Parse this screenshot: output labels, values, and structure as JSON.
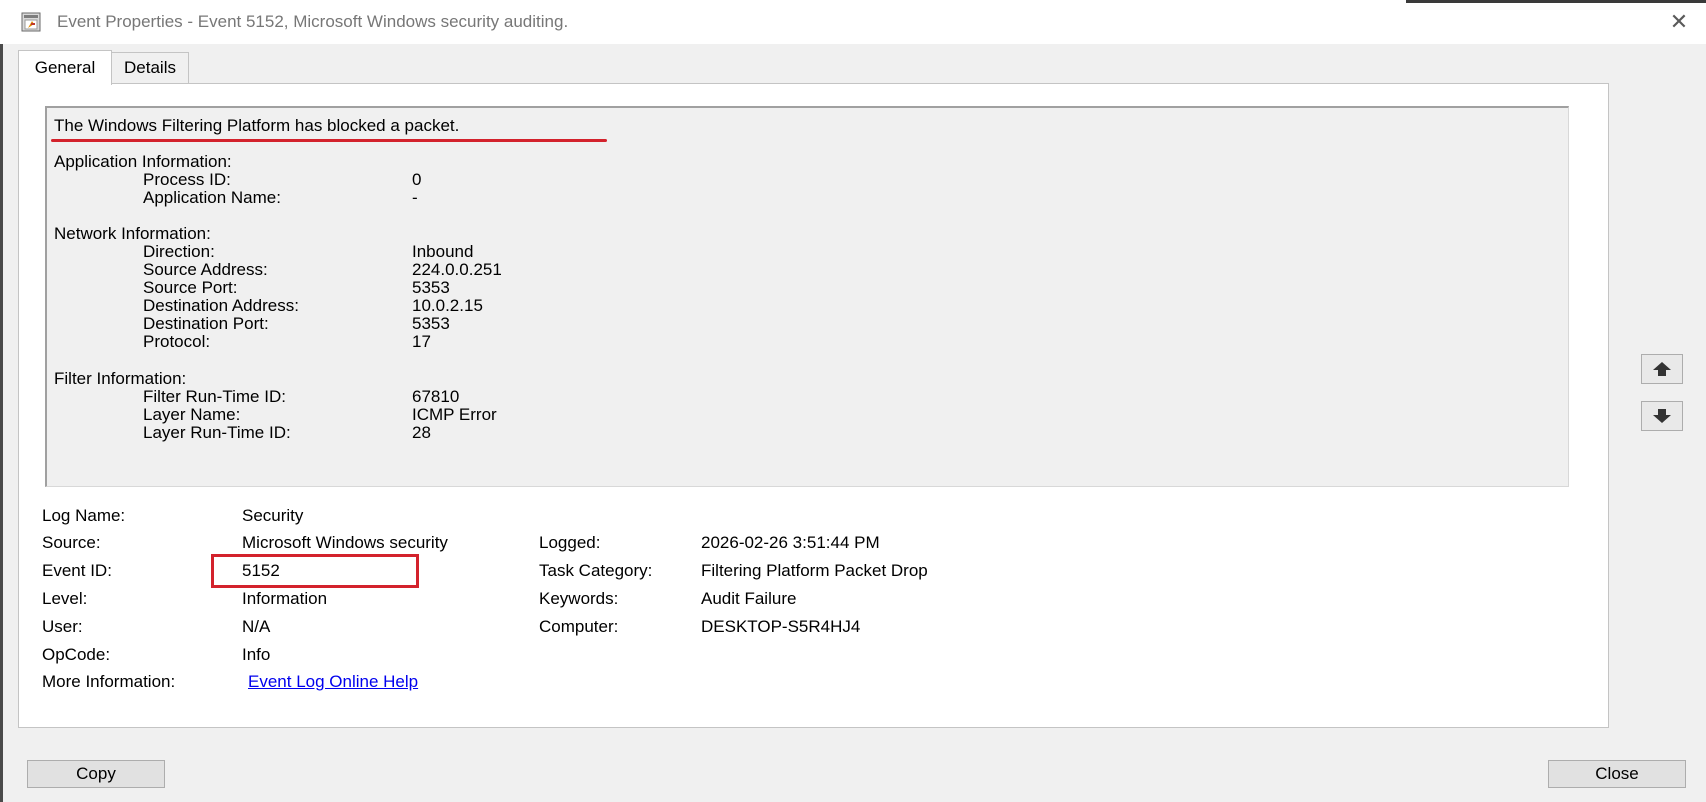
{
  "window": {
    "title": "Event Properties - Event 5152, Microsoft Windows security auditing.",
    "close_glyph": "✕"
  },
  "tabs": [
    {
      "label": "General",
      "active": true
    },
    {
      "label": "Details",
      "active": false
    }
  ],
  "description": {
    "headline": "The Windows Filtering Platform has blocked a packet.",
    "sections": [
      {
        "title": "Application Information:",
        "rows": [
          {
            "label": "Process ID:",
            "value": "0"
          },
          {
            "label": "Application Name:",
            "value": "-"
          }
        ]
      },
      {
        "title": "Network Information:",
        "rows": [
          {
            "label": "Direction:",
            "value": "Inbound"
          },
          {
            "label": "Source Address:",
            "value": "224.0.0.251"
          },
          {
            "label": "Source Port:",
            "value": "5353"
          },
          {
            "label": "Destination Address:",
            "value": "10.0.2.15"
          },
          {
            "label": "Destination Port:",
            "value": "5353"
          },
          {
            "label": "Protocol:",
            "value": "17"
          }
        ]
      },
      {
        "title": "Filter Information:",
        "rows": [
          {
            "label": "Filter Run-Time ID:",
            "value": "67810"
          },
          {
            "label": "Layer Name:",
            "value": "ICMP Error"
          },
          {
            "label": "Layer Run-Time ID:",
            "value": "28"
          }
        ]
      }
    ]
  },
  "meta": {
    "log_name_label": "Log Name:",
    "log_name": "Security",
    "source_label": "Source:",
    "source": "Microsoft Windows security",
    "logged_label": "Logged:",
    "logged": "2026-02-26 3:51:44 PM",
    "event_id_label": "Event ID:",
    "event_id": "5152",
    "task_category_label": "Task Category:",
    "task_category": "Filtering Platform Packet Drop",
    "level_label": "Level:",
    "level": "Information",
    "keywords_label": "Keywords:",
    "keywords": "Audit Failure",
    "user_label": "User:",
    "user": "N/A",
    "computer_label": "Computer:",
    "computer": "DESKTOP-S5R4HJ4",
    "opcode_label": "OpCode:",
    "opcode": "Info",
    "more_info_label": "More Information:",
    "more_info_link": "Event Log Online Help"
  },
  "buttons": {
    "copy": "Copy",
    "close": "Close"
  },
  "icons": {
    "title": "event-properties-icon",
    "up": "arrow-up-icon",
    "down": "arrow-down-icon"
  },
  "colors": {
    "annotation_red": "#d3222c",
    "link": "#0000ee"
  }
}
